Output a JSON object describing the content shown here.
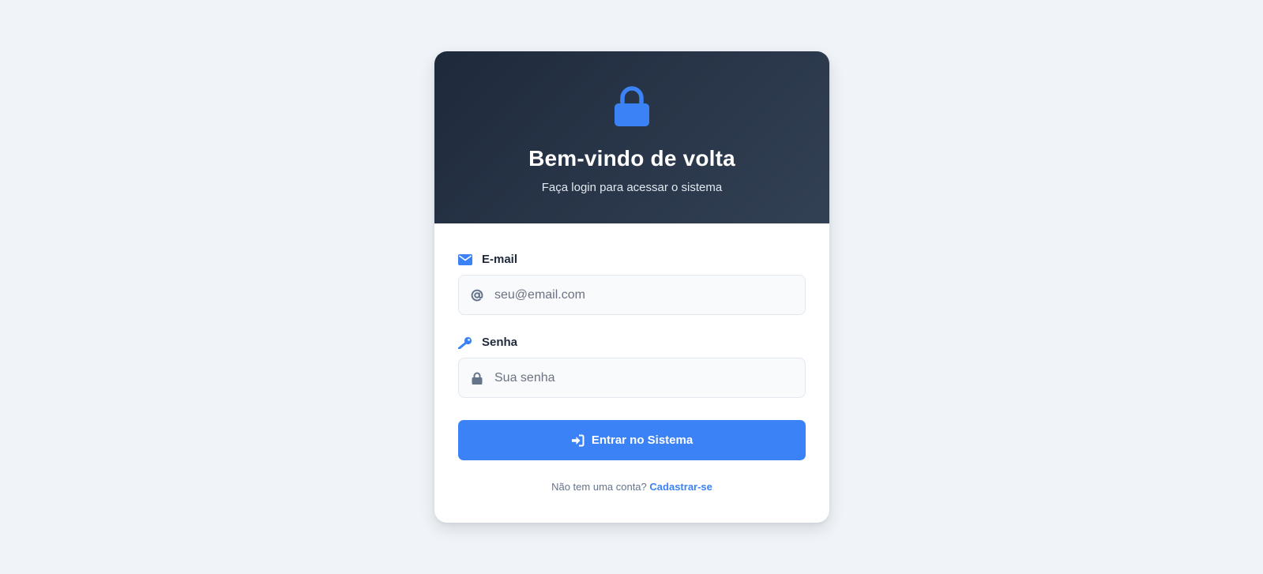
{
  "header": {
    "icon": "lock-icon",
    "title": "Bem-vindo de volta",
    "subtitle": "Faça login para acessar o sistema"
  },
  "form": {
    "email": {
      "label": "E-mail",
      "label_icon": "envelope-icon",
      "input_icon": "at-icon",
      "placeholder": "seu@email.com",
      "value": ""
    },
    "password": {
      "label": "Senha",
      "label_icon": "key-icon",
      "input_icon": "lock-icon",
      "placeholder": "Sua senha",
      "value": ""
    },
    "submit": {
      "label": "Entrar no Sistema",
      "icon": "sign-in-icon"
    }
  },
  "footer": {
    "prompt": "Não tem uma conta?",
    "link_label": "Cadastrar-se"
  },
  "colors": {
    "accent": "#3b82f6",
    "header_bg_start": "#1e293b",
    "header_bg_end": "#334155",
    "page_bg": "#f0f4f8"
  }
}
